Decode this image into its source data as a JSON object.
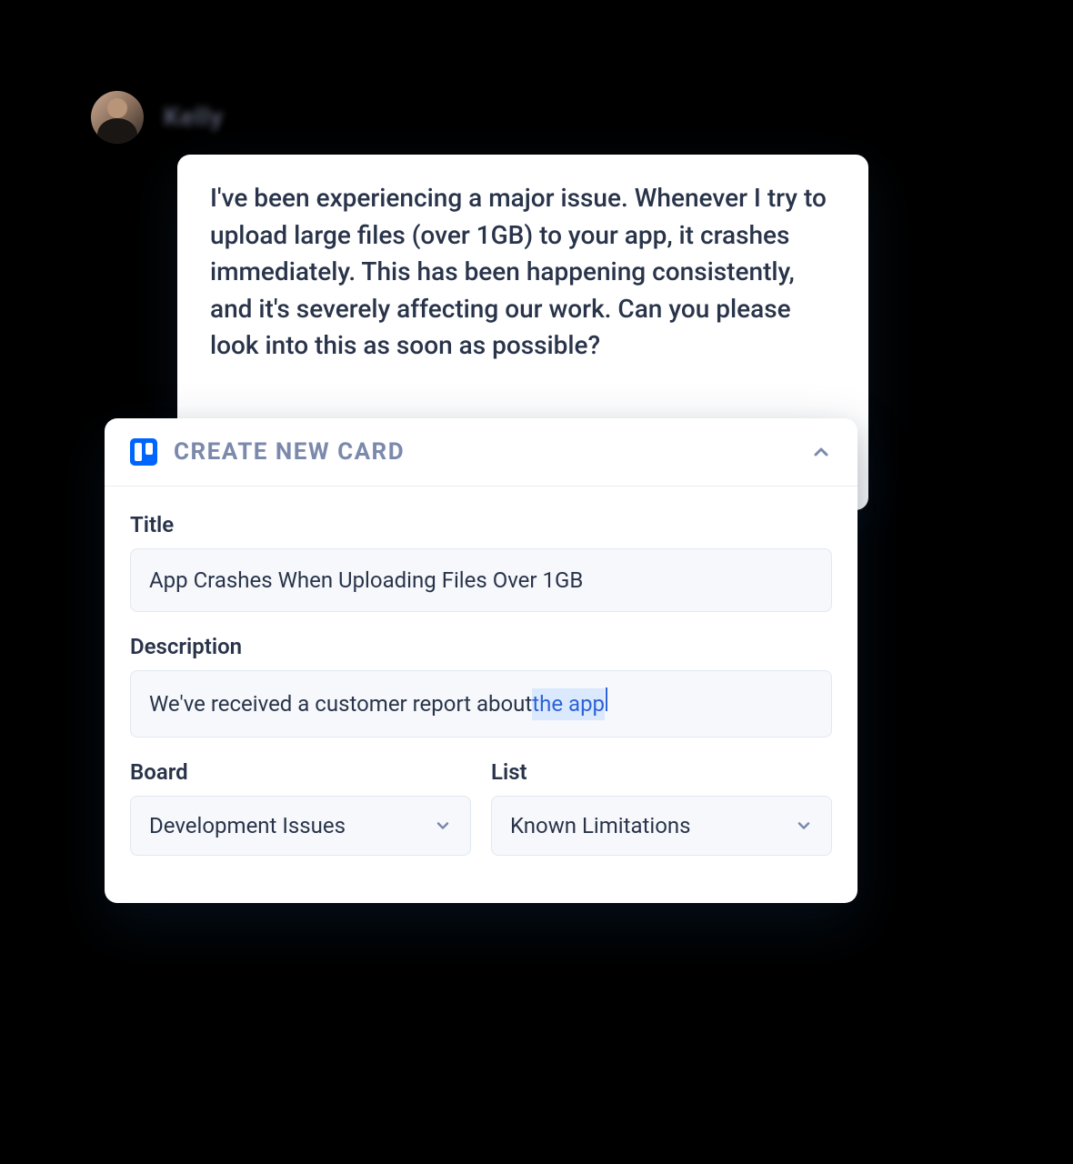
{
  "message": {
    "author": "Kelly",
    "body": "I've been experiencing a major issue. Whenever I try to upload large files (over 1GB) to your app, it crashes immediately. This has been happening consistently, and it's severely affecting our work. Can you please look into this as soon as possible?"
  },
  "panel": {
    "header": "CREATE NEW CARD",
    "title_label": "Title",
    "title_value": "App Crashes When Uploading Files Over 1GB",
    "description_label": "Description",
    "description_prefix": "We've received a customer report about ",
    "description_highlight": "the app",
    "board_label": "Board",
    "board_value": "Development Issues",
    "list_label": "List",
    "list_value": "Known Limitations"
  }
}
